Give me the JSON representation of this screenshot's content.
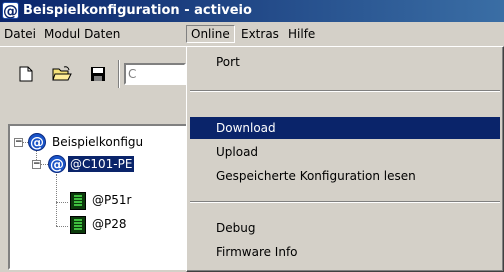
{
  "window": {
    "title": "Beispielkonfiguration - activeio",
    "app_icon_glyph": "@"
  },
  "menubar": {
    "items": [
      "Datei",
      "Modul Daten",
      "Online",
      "Extras",
      "Hilfe"
    ],
    "active": "Online"
  },
  "toolbar": {
    "buttons": [
      "new-document-icon",
      "open-folder-icon",
      "save-disk-icon"
    ],
    "combo_text": "C"
  },
  "tree": {
    "nodes": [
      {
        "label": "Beispielkonfigu",
        "icon": "at-icon",
        "expander": "−"
      },
      {
        "label": "@C101-PE",
        "icon": "at-icon",
        "expander": "−",
        "selected": true
      },
      {
        "label": "@P51r",
        "icon": "module-icon"
      },
      {
        "label": "@P28",
        "icon": "module-icon"
      }
    ]
  },
  "online_menu": {
    "items": [
      {
        "label": "Port"
      },
      {
        "label": "Download",
        "highlighted": true
      },
      {
        "label": "Upload"
      },
      {
        "label": "Gespeicherte Konfiguration lesen"
      },
      {
        "label": "Debug"
      },
      {
        "label": "Firmware Info"
      }
    ]
  }
}
